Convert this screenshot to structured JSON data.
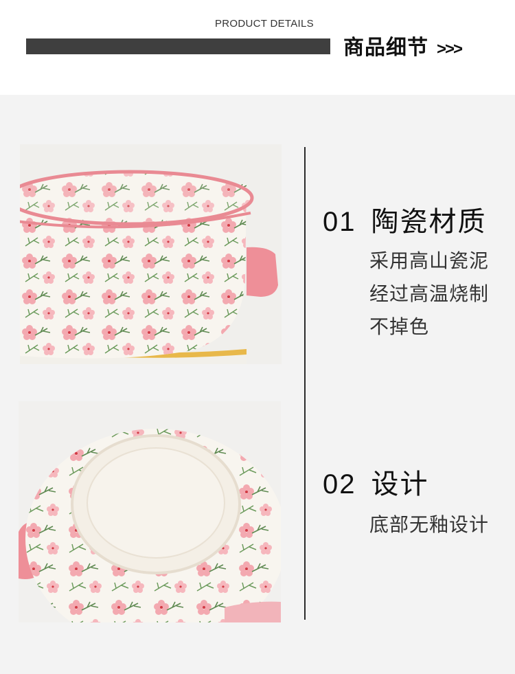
{
  "header": {
    "subtitle": "PRODUCT DETAILS",
    "title": "商品细节",
    "arrows": ">>>"
  },
  "features": [
    {
      "number": "01",
      "title": "陶瓷材质",
      "lines": [
        "采用高山瓷泥",
        "经过高温烧制",
        "不掉色"
      ]
    },
    {
      "number": "02",
      "title": "设计",
      "lines": [
        "底部无釉设计"
      ]
    }
  ],
  "colors": {
    "background": "#f3f3f3",
    "bar": "#3f3f3f",
    "bowl_white": "#f8f5ef",
    "flower_pink": "#f3a9b0",
    "rim_pink": "#e98a93",
    "leaf_green": "#5f8a52",
    "base_yellow": "#e8b84a"
  }
}
